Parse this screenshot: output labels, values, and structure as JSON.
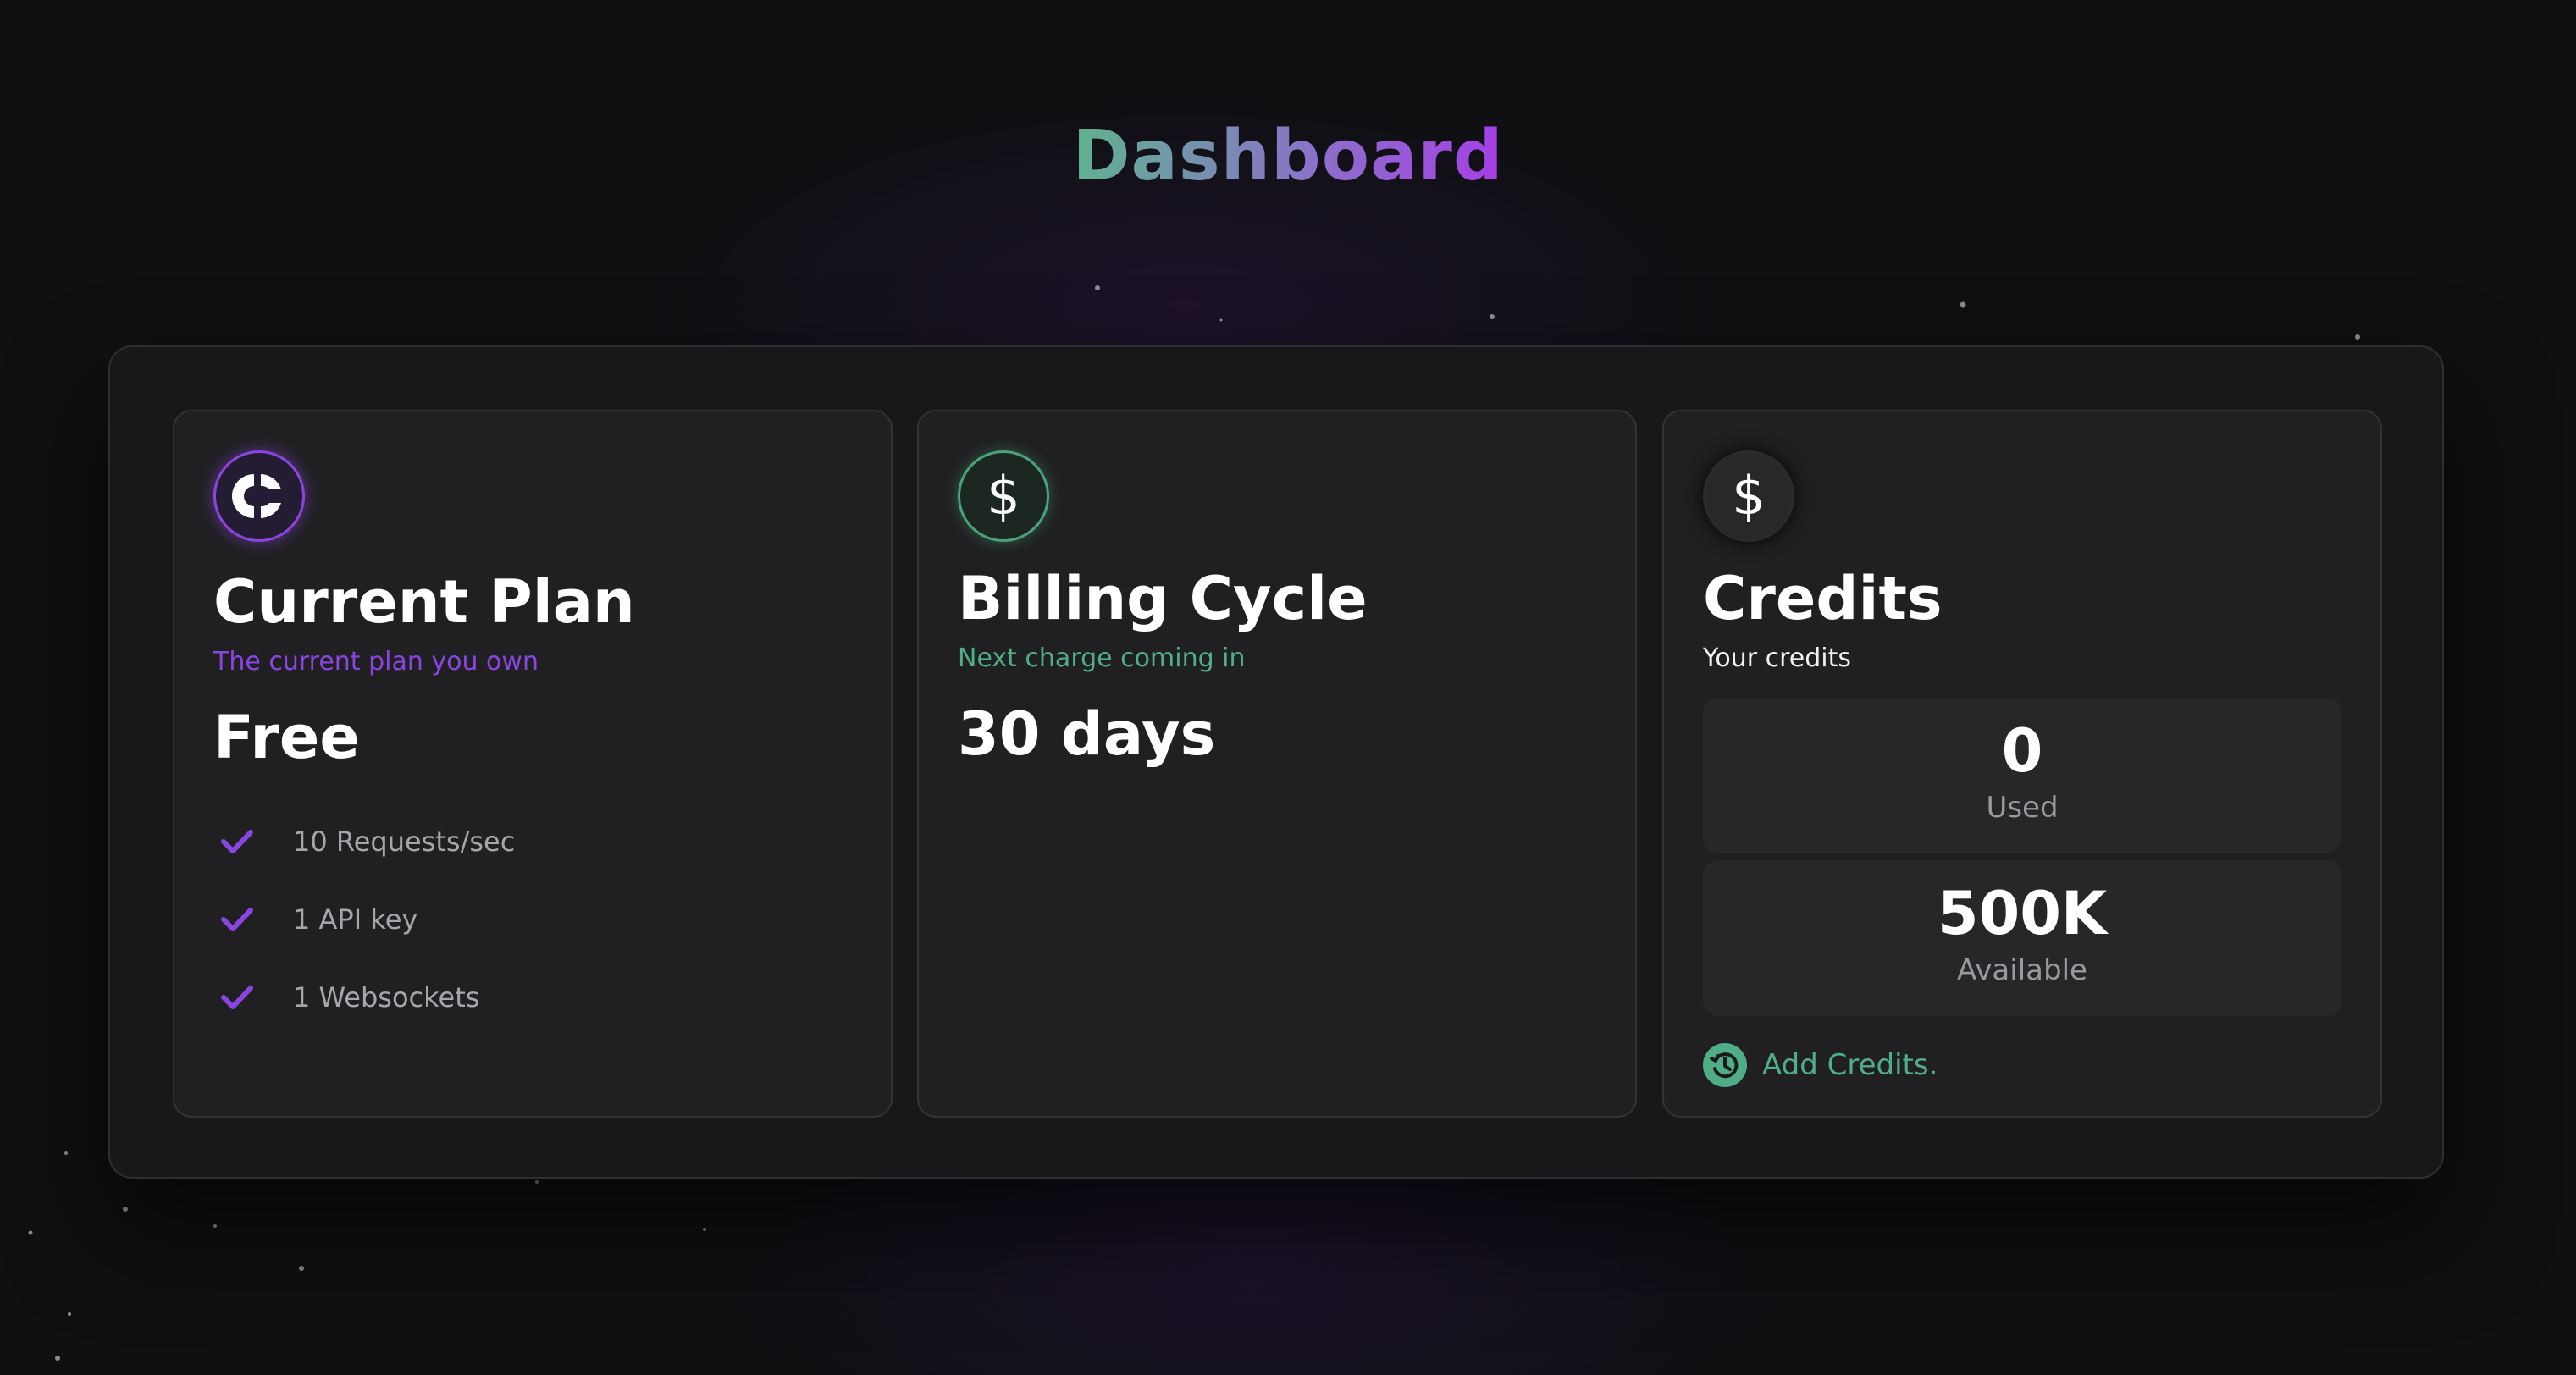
{
  "page": {
    "title": "Dashboard"
  },
  "colors": {
    "background": "#0f1012",
    "panel": "#18181b",
    "card": "#202022",
    "accent_purple": "#8a45e0",
    "accent_green": "#4fae85",
    "title_gradient_start": "#5fb38e",
    "title_gradient_end": "#a53ee6"
  },
  "current_plan": {
    "icon": "plan-logo-icon",
    "title": "Current Plan",
    "subtitle": "The current plan you own",
    "plan_name": "Free",
    "features": [
      {
        "icon": "check-icon",
        "label": "10 Requests/sec"
      },
      {
        "icon": "check-icon",
        "label": "1 API key"
      },
      {
        "icon": "check-icon",
        "label": "1 Websockets"
      }
    ]
  },
  "billing_cycle": {
    "icon": "dollar-icon",
    "title": "Billing Cycle",
    "subtitle": "Next charge coming in",
    "value": "30 days"
  },
  "credits": {
    "icon": "dollar-icon",
    "title": "Credits",
    "subtitle": "Your credits",
    "used": {
      "value": "0",
      "label": "Used"
    },
    "available": {
      "value": "500K",
      "label": "Available"
    },
    "add_credits": {
      "icon": "history-clock-icon",
      "label": "Add Credits."
    }
  }
}
